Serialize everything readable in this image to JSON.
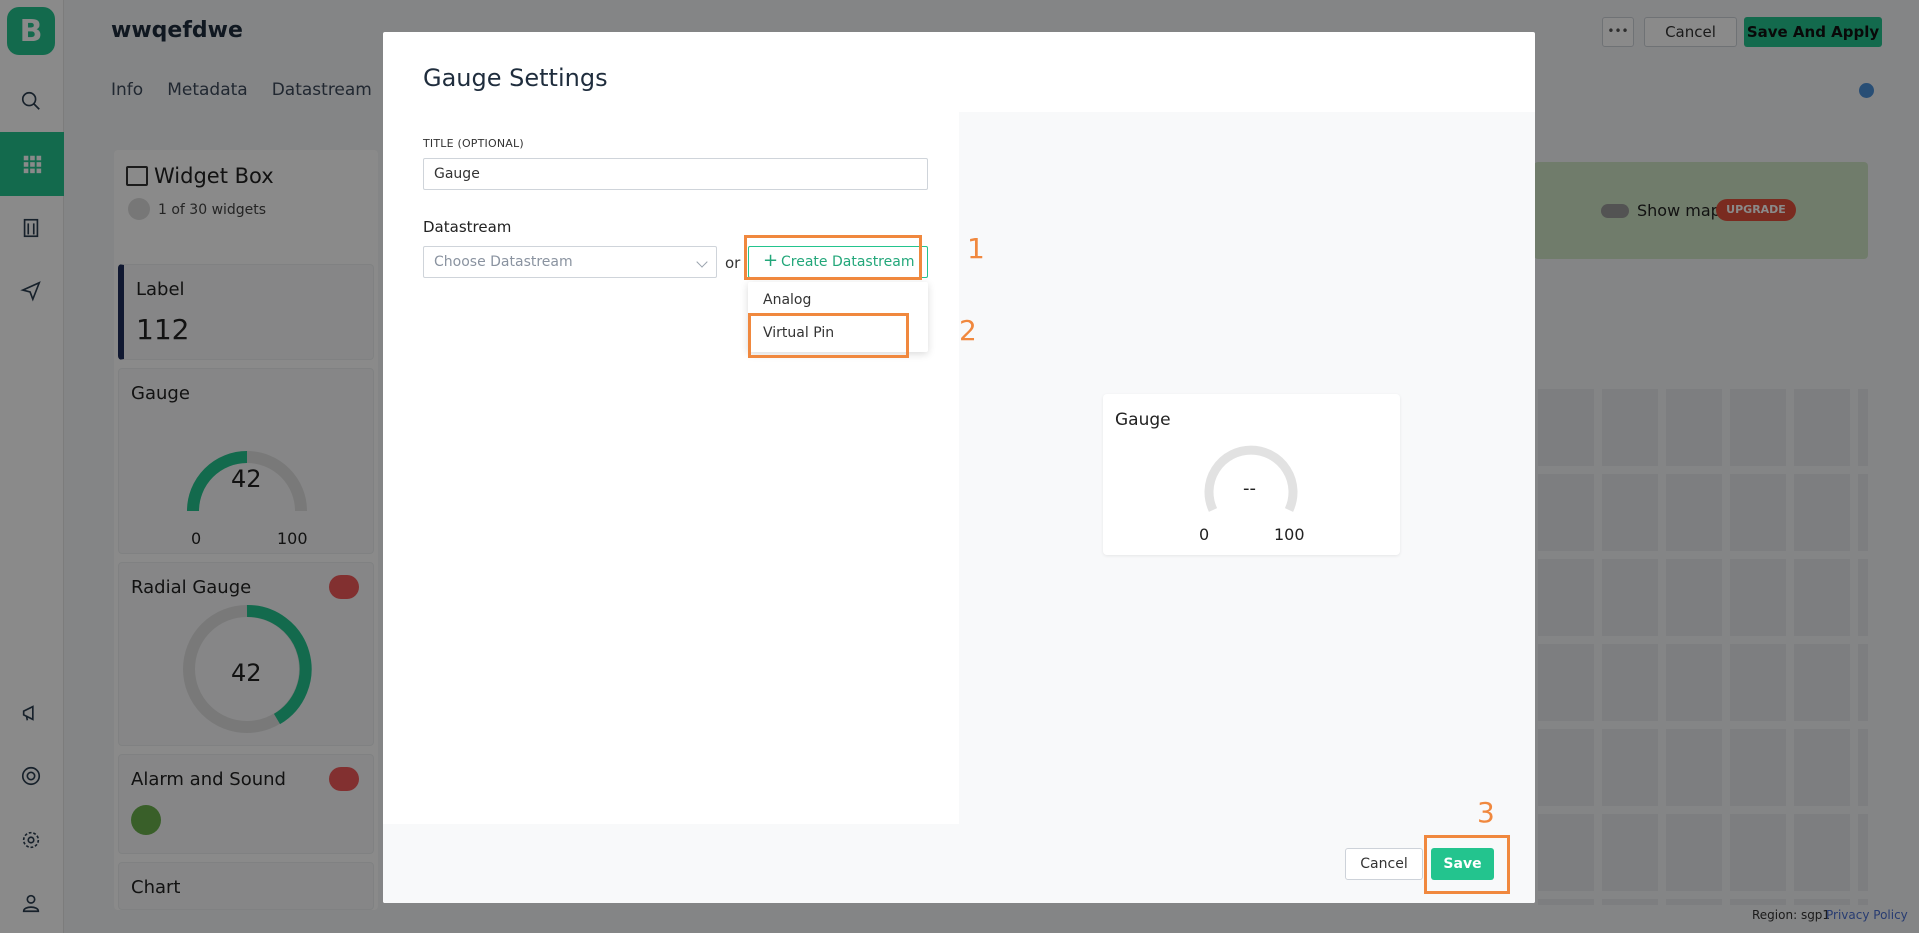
{
  "app": {
    "logo_letter": "B",
    "project_title": "wwqefdwe",
    "tabs": [
      "Info",
      "Metadata",
      "Datastream"
    ],
    "more_label": "•••",
    "cancel_label": "Cancel",
    "save_apply_label": "Save And Apply",
    "show_map_label": "Show map",
    "upgrade_label": "UPGRADE",
    "region_text": "Region: sgp1",
    "privacy_label": "Privacy Policy"
  },
  "widget_box": {
    "title": "Widget Box",
    "count_text": "1 of 30 widgets",
    "widgets": [
      {
        "title": "Label",
        "value": "112"
      },
      {
        "title": "Gauge",
        "value": "42",
        "min": "0",
        "max": "100",
        "level": 0.42
      },
      {
        "title": "Radial Gauge",
        "value": "42",
        "level": 0.42
      },
      {
        "title": "Alarm and Sound"
      },
      {
        "title": "Chart"
      }
    ]
  },
  "modal": {
    "title": "Gauge Settings",
    "title_field_label": "TITLE (OPTIONAL)",
    "title_field_value": "Gauge",
    "datastream_label": "Datastream",
    "datastream_placeholder": "Choose Datastream",
    "or_text": "or",
    "create_datastream_label": "Create Datastream",
    "dropdown_items": [
      "Analog",
      "Virtual Pin"
    ],
    "preview": {
      "title": "Gauge",
      "value": "--",
      "min": "0",
      "max": "100"
    },
    "cancel_label": "Cancel",
    "save_label": "Save"
  },
  "annotations": [
    "1",
    "2",
    "3"
  ],
  "colors": {
    "accent": "#23c48e",
    "highlight": "#f0883e"
  }
}
